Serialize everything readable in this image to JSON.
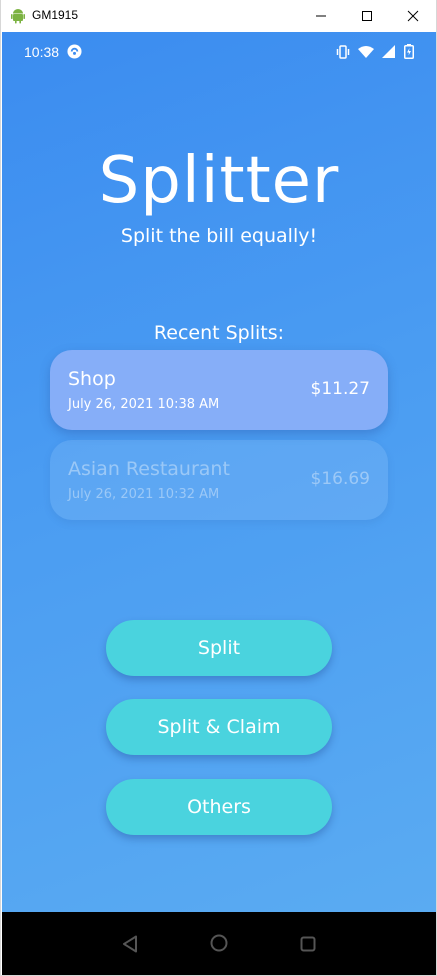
{
  "window": {
    "title": "GM1915"
  },
  "status_bar": {
    "time": "10:38"
  },
  "app": {
    "title": "Splitter",
    "subtitle": "Split the bill equally!",
    "recent_heading": "Recent Splits:"
  },
  "recent_splits": [
    {
      "name": "Shop",
      "date": "July 26, 2021 10:38 AM",
      "amount": "$11.27"
    },
    {
      "name": "Asian Restaurant",
      "date": "July 26, 2021 10:32 AM",
      "amount": "$16.69"
    }
  ],
  "actions": {
    "split_label": "Split",
    "split_claim_label": "Split & Claim",
    "others_label": "Others"
  },
  "icons": {
    "app": "android-icon",
    "sync": "sync-icon",
    "vibrate": "vibrate-icon",
    "wifi": "wifi-icon",
    "signal": "signal-icon",
    "battery": "battery-icon",
    "back": "back-icon",
    "home": "home-icon",
    "recents": "recents-icon"
  },
  "colors": {
    "background_top": "#3b8cf0",
    "background_bottom": "#5aabf2",
    "card_active": "#86aef8",
    "button": "#4ad3de",
    "text": "#ffffff"
  }
}
